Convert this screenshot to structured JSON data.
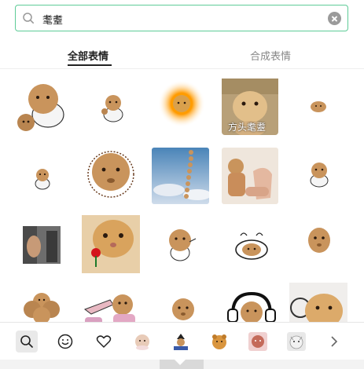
{
  "search": {
    "query": "耄耋",
    "icon": "search-icon",
    "clear_icon": "clear-icon"
  },
  "tabs": [
    {
      "label": "全部表情",
      "active": true
    },
    {
      "label": "合成表情",
      "active": false
    }
  ],
  "stickers": [
    {
      "name": "cat-sticker-1",
      "caption": ""
    },
    {
      "name": "cat-sticker-2",
      "caption": ""
    },
    {
      "name": "sun-cat-sticker",
      "caption": ""
    },
    {
      "name": "cat-sticker-4",
      "caption": "方头耄耋"
    },
    {
      "name": "cat-sticker-5",
      "caption": ""
    },
    {
      "name": "cat-sticker-6",
      "caption": ""
    },
    {
      "name": "cat-sticker-7",
      "caption": ""
    },
    {
      "name": "sky-cat-sticker",
      "caption": ""
    },
    {
      "name": "cat-sticker-9",
      "caption": ""
    },
    {
      "name": "cat-sticker-10",
      "caption": ""
    },
    {
      "name": "cat-sticker-11",
      "caption": ""
    },
    {
      "name": "rose-cat-sticker",
      "caption": ""
    },
    {
      "name": "cat-sticker-13",
      "caption": ""
    },
    {
      "name": "cat-sticker-14",
      "caption": ""
    },
    {
      "name": "cat-sticker-15",
      "caption": ""
    },
    {
      "name": "cat-sticker-16",
      "caption": ""
    },
    {
      "name": "cat-sticker-17",
      "caption": ""
    },
    {
      "name": "cat-sticker-18",
      "caption": ""
    },
    {
      "name": "cat-sticker-19",
      "caption": ""
    },
    {
      "name": "cat-sticker-20",
      "caption": ""
    }
  ],
  "toolbar": {
    "items": [
      "search-icon",
      "smiley-icon",
      "heart-icon",
      "sticker-pack-1",
      "sticker-pack-2",
      "sticker-pack-3",
      "sticker-pack-4",
      "sticker-pack-5",
      "chevron-right-icon"
    ],
    "selected": "search-icon"
  },
  "colors": {
    "accent": "#5ecb97",
    "cat_fur": "#c9945c",
    "cat_fur_dark": "#8a5a2e"
  }
}
